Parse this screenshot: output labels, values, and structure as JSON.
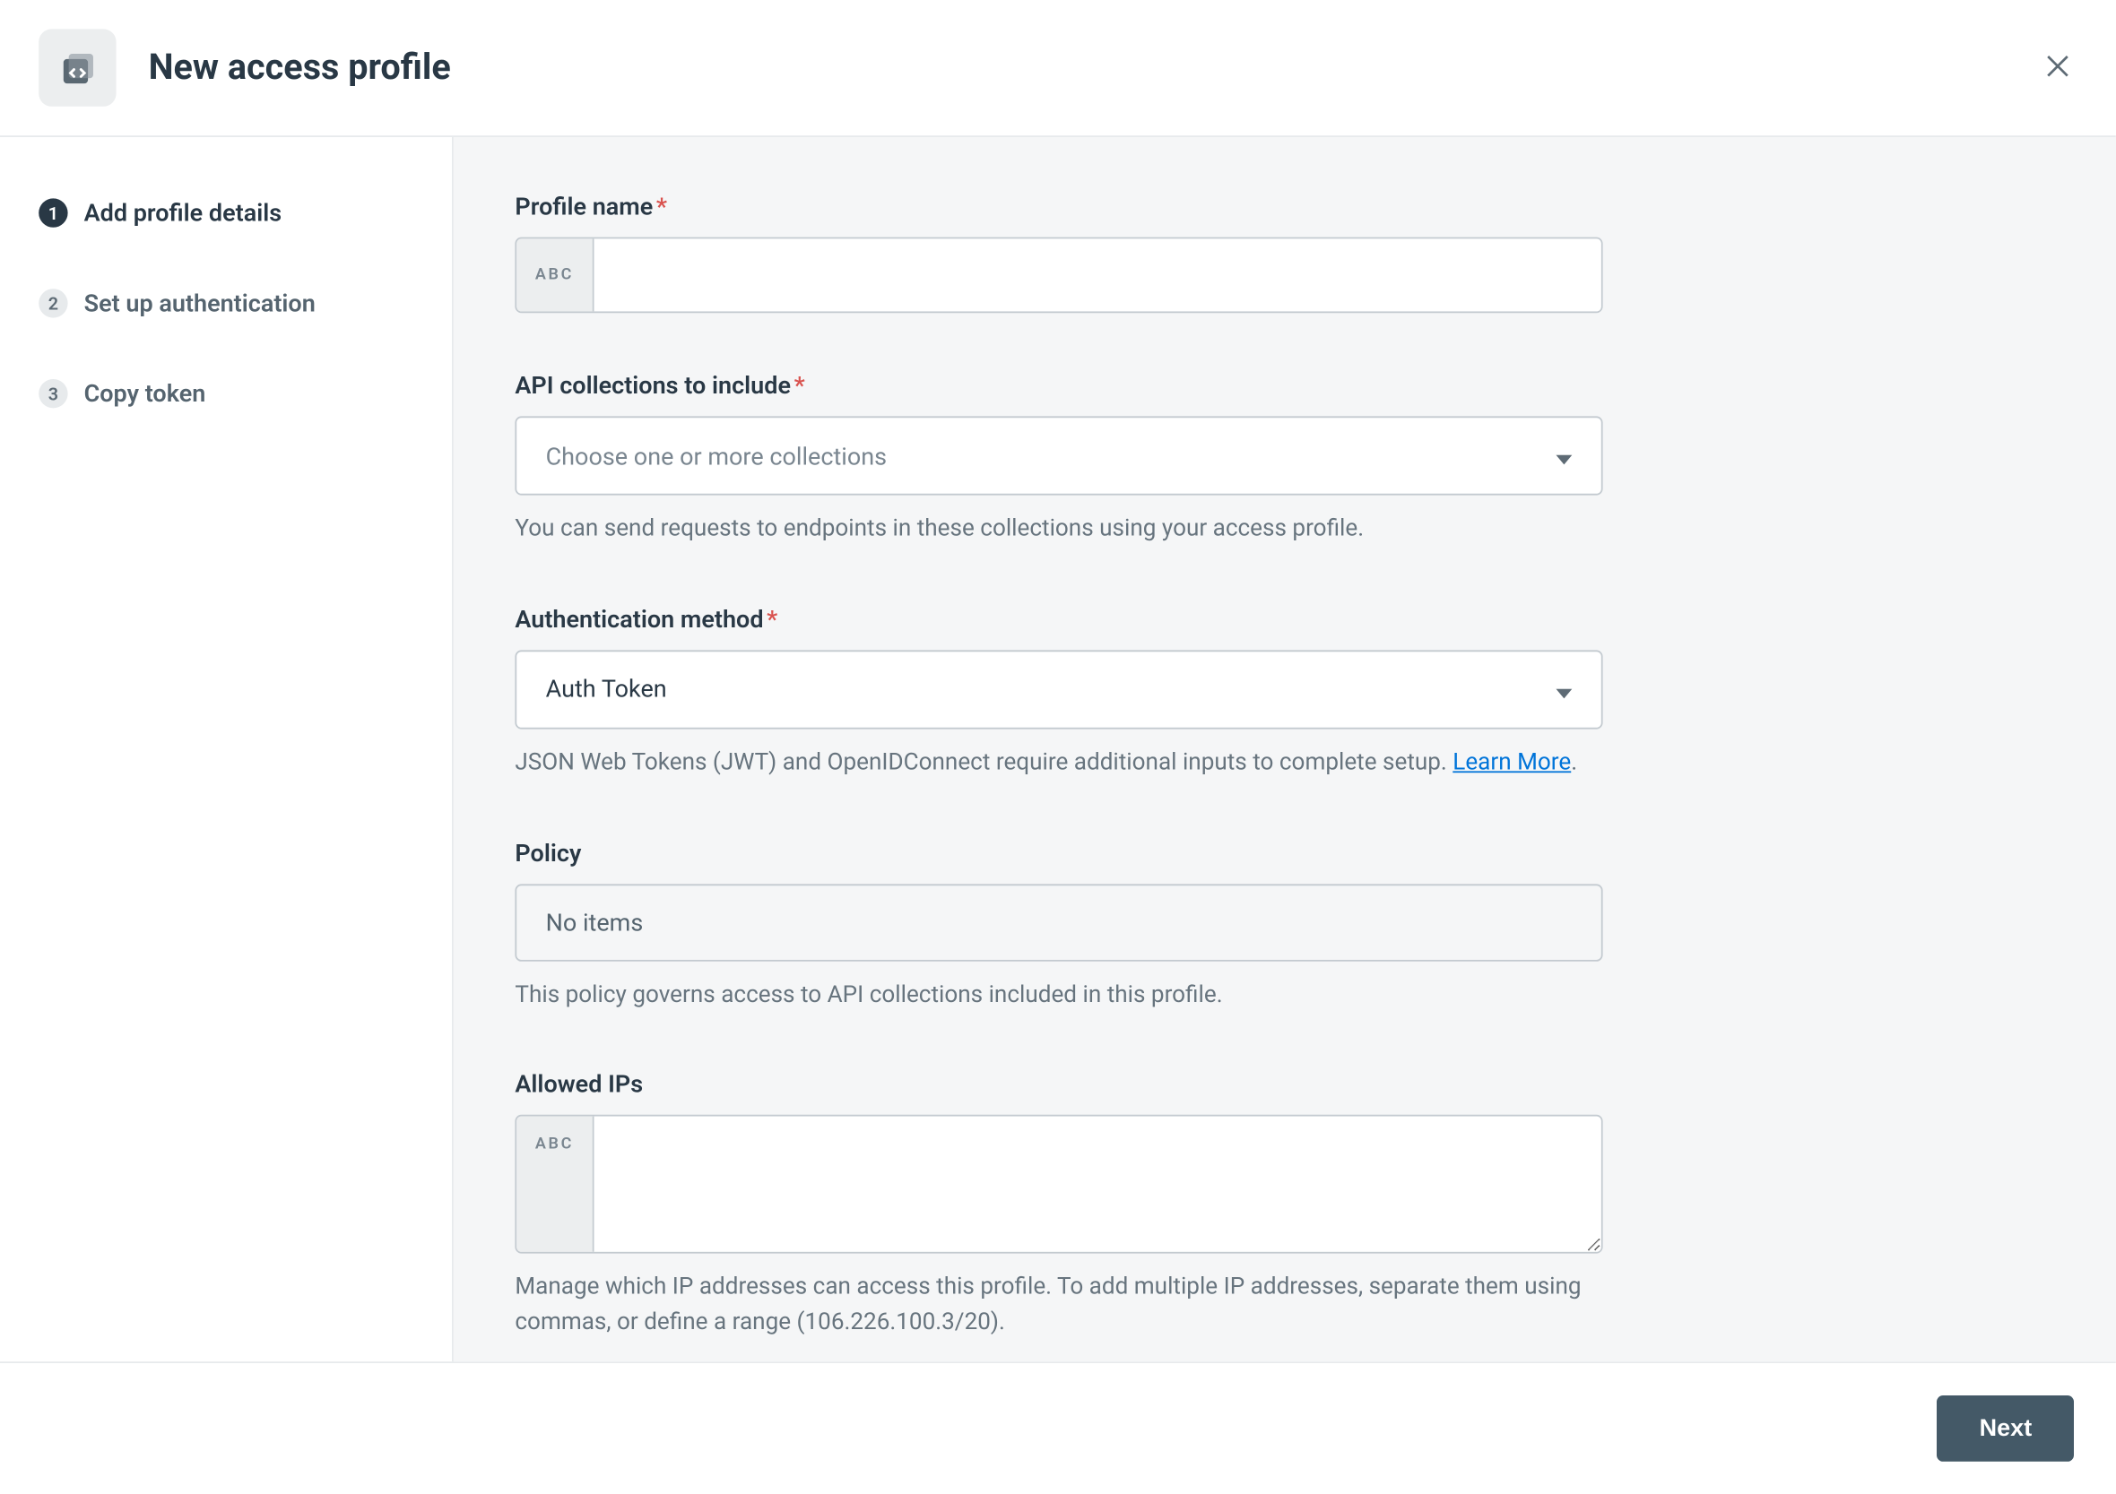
{
  "header": {
    "title": "New access profile"
  },
  "sidebar": {
    "steps": [
      {
        "num": "1",
        "label": "Add profile details",
        "active": true
      },
      {
        "num": "2",
        "label": "Set up authentication",
        "active": false
      },
      {
        "num": "3",
        "label": "Copy token",
        "active": false
      }
    ]
  },
  "form": {
    "profile_name": {
      "label": "Profile name",
      "prefix": "ABC",
      "value": ""
    },
    "collections": {
      "label": "API collections to include",
      "placeholder": "Choose one or more collections",
      "help": "You can send requests to endpoints in these collections using your access profile."
    },
    "auth_method": {
      "label": "Authentication method",
      "value": "Auth Token",
      "help_pre": "JSON Web Tokens (JWT) and OpenIDConnect require additional inputs to complete setup. ",
      "help_link": "Learn More",
      "help_post": "."
    },
    "policy": {
      "label": "Policy",
      "value": "No items",
      "help": "This policy governs access to API collections included in this profile."
    },
    "allowed_ips": {
      "label": "Allowed IPs",
      "prefix": "ABC",
      "value": "",
      "help": "Manage which IP addresses can access this profile. To add multiple IP addresses, separate them using commas, or define a range (106.226.100.3/20)."
    }
  },
  "footer": {
    "next": "Next"
  }
}
